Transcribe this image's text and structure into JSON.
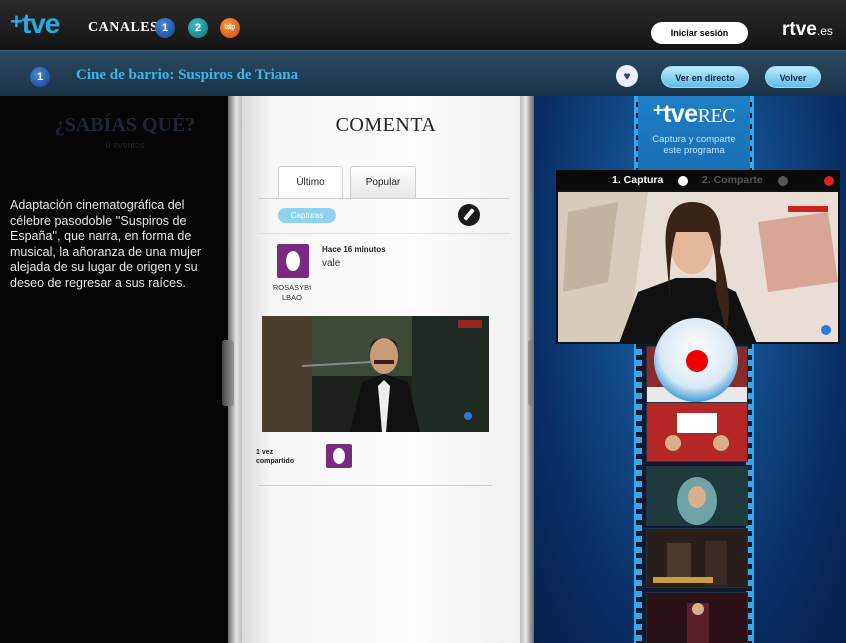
{
  "topbar": {
    "logo_text": "tve",
    "logo_plus": "+",
    "canales_label": "CANALES",
    "channels": [
      "1",
      "2",
      "tdp"
    ],
    "login_label": "Iniciar sesión",
    "brand": "rtve",
    "brand_suffix": ".es"
  },
  "subbar": {
    "channel_number": "1",
    "title": "Cine de barrio: Suspiros de Triana",
    "heart_icon": "♥",
    "live_label": "Ver en directo",
    "back_label": "Volver"
  },
  "left": {
    "heading": "¿SABÍAS QUÉ?",
    "subheading": "0 eventos",
    "description": "Adaptación cinematográfica del célebre pasodoble ''Suspiros de España'', que narra, en forma de musical, la añoranza de una mujer alejada de su lugar de origen y su deseo de regresar a sus raíces."
  },
  "center": {
    "heading": "COMENTA",
    "tabs": [
      {
        "label": "Último"
      },
      {
        "label": "Popular"
      }
    ],
    "filter_badge": "Capturas",
    "comment": {
      "time": "Hace 16 minutos",
      "text": "vale",
      "user_line1": "ROSASYBI",
      "user_line2": "LBAO"
    },
    "shared_line1": "1 vez",
    "shared_line2": "compartido"
  },
  "right": {
    "rec_plus": "+",
    "rec_brand": "tve",
    "rec_suffix": "REC",
    "rec_subtitle_1": "Captura y comparte",
    "rec_subtitle_2": "este programa",
    "step1": "1. Captura",
    "step2": "2. Comparte"
  },
  "colors": {
    "accent": "#29a9e0",
    "title_blue": "#3eb6e8",
    "rec_red": "#e00000"
  }
}
